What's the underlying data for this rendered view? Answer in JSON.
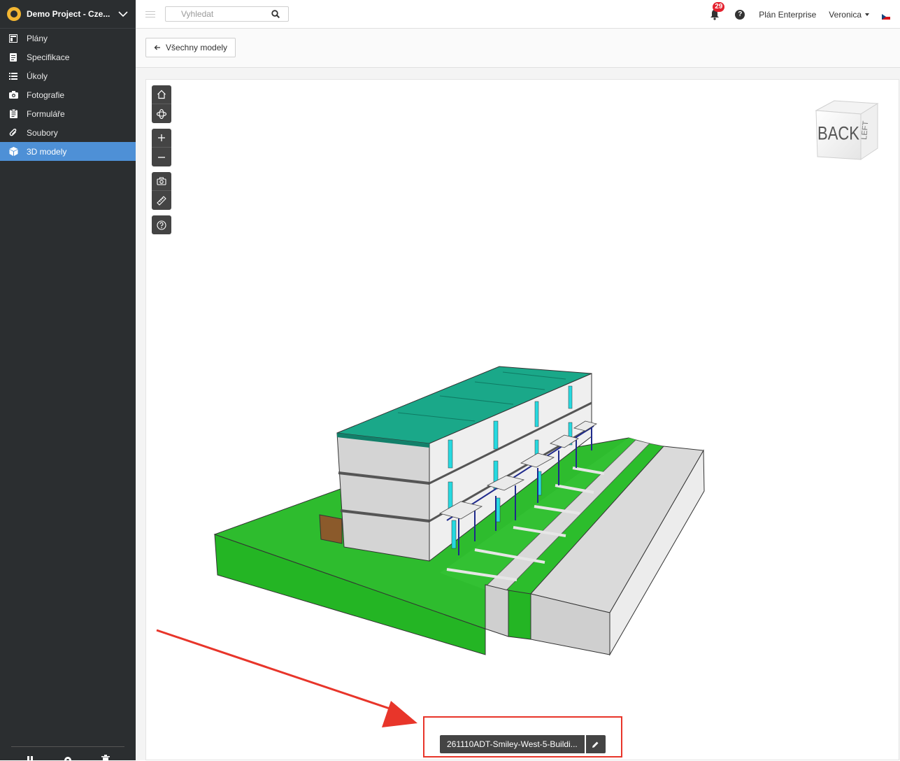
{
  "sidebar": {
    "project_title": "Demo Project - Cze...",
    "items": [
      {
        "label": "Plány",
        "icon": "plans-icon",
        "active": false
      },
      {
        "label": "Specifikace",
        "icon": "specification-icon",
        "active": false
      },
      {
        "label": "Úkoly",
        "icon": "list-icon",
        "active": false
      },
      {
        "label": "Fotografie",
        "icon": "camera-icon",
        "active": false
      },
      {
        "label": "Formuláře",
        "icon": "clipboard-icon",
        "active": false
      },
      {
        "label": "Soubory",
        "icon": "paperclip-icon",
        "active": false
      },
      {
        "label": "3D modely",
        "icon": "cube-icon",
        "active": true
      }
    ],
    "active_color": "#4e90d6"
  },
  "topbar": {
    "search_placeholder": "Vyhledat",
    "notification_count": "29",
    "help_label": "?",
    "plan_label": "Plán Enterprise",
    "user_name": "Veronica"
  },
  "subbar": {
    "back_label": "Všechny modely"
  },
  "viewer": {
    "viewcube_front": "BACK",
    "viewcube_side": "LEFT",
    "model_name": "261110ADT-Smiley-West-5-Buildi..."
  },
  "colors": {
    "highlight": "#e8352a",
    "badge": "#e4212e",
    "grass": "#2ebc2e",
    "roof": "#1aa889"
  }
}
